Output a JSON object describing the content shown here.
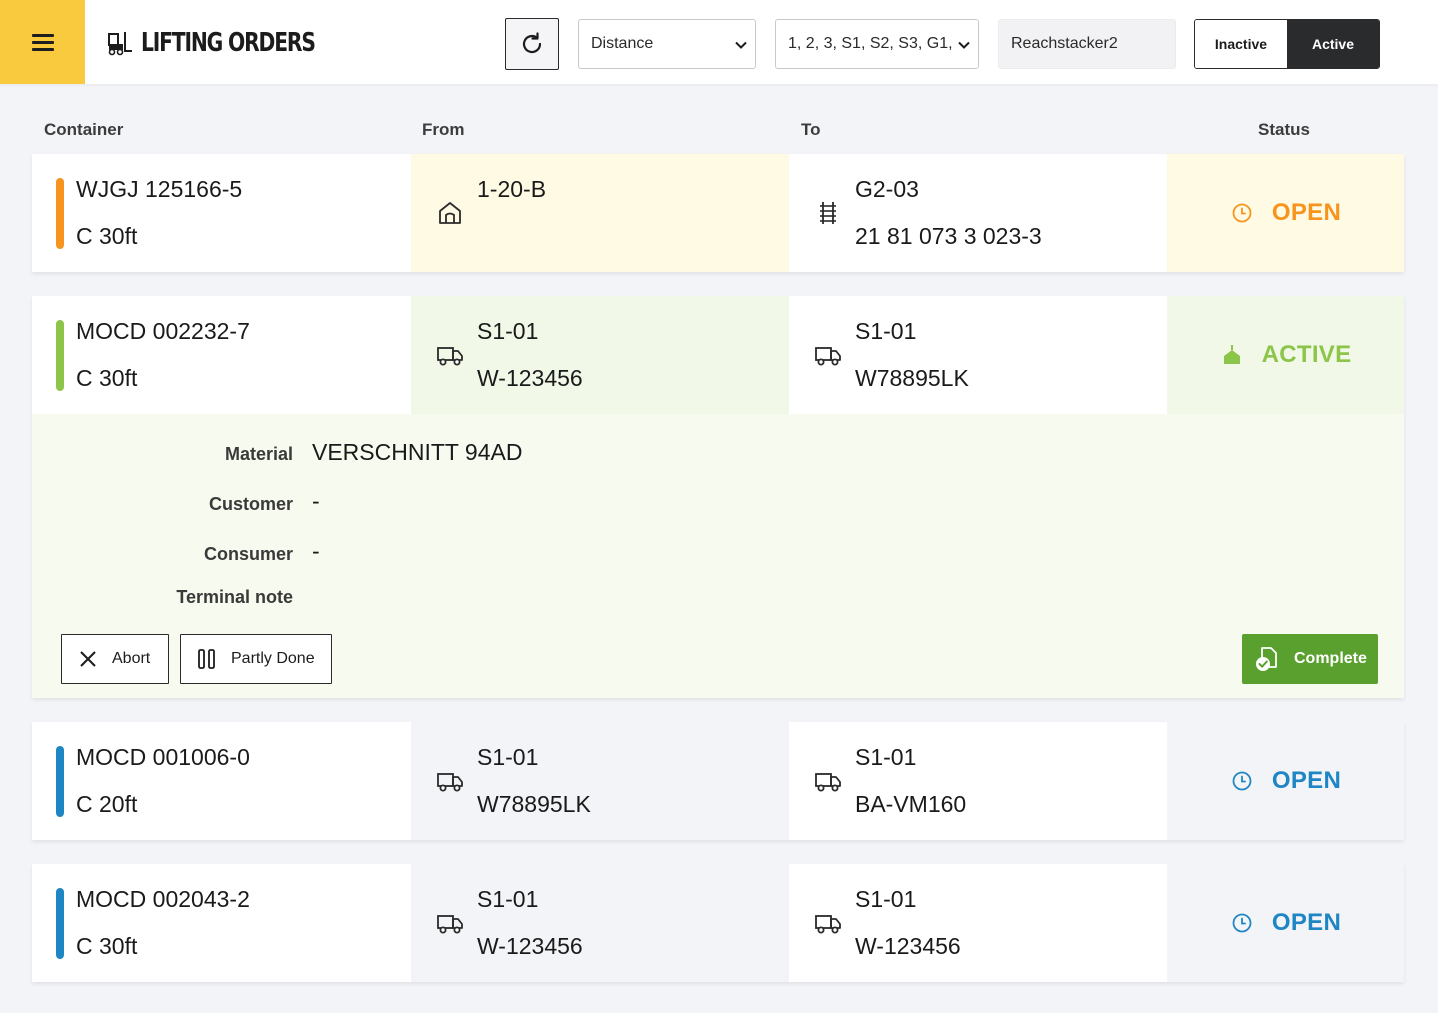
{
  "header": {
    "title": "LIFTING ORDERS",
    "sort_select": "Distance",
    "zone_select": "1, 2, 3, S1, S2, S3, G1, …",
    "machine": "Reachstacker2",
    "toggle_inactive": "Inactive",
    "toggle_active": "Active",
    "active_toggle": "Active"
  },
  "columns": {
    "container": "Container",
    "from": "From",
    "to": "To",
    "status": "Status"
  },
  "orders": [
    {
      "container_id": "WJGJ 125166-5",
      "container_type": "C 30ft",
      "from_icon": "warehouse-icon",
      "from_line1": "1-20-B",
      "from_line2": "",
      "to_icon": "rail-track-icon",
      "to_line1": "G2-03",
      "to_line2": "21 81 073 3 023-3",
      "status": "OPEN",
      "status_icon": "clock-icon",
      "accent": "#f7941d"
    },
    {
      "container_id": "MOCD 002232-7",
      "container_type": "C 30ft",
      "from_icon": "truck-icon",
      "from_line1": "S1-01",
      "from_line2": "W-123456",
      "to_icon": "truck-icon",
      "to_line1": "S1-01",
      "to_line2": "W78895LK",
      "status": "ACTIVE",
      "status_icon": "crane-lift-icon",
      "accent": "#8cc54a"
    },
    {
      "container_id": "MOCD 001006-0",
      "container_type": "C 20ft",
      "from_icon": "truck-icon",
      "from_line1": "S1-01",
      "from_line2": "W78895LK",
      "to_icon": "truck-icon",
      "to_line1": "S1-01",
      "to_line2": "BA-VM160",
      "status": "OPEN",
      "status_icon": "clock-icon",
      "accent": "#1f86c4"
    },
    {
      "container_id": "MOCD 002043-2",
      "container_type": "C 30ft",
      "from_icon": "truck-icon",
      "from_line1": "S1-01",
      "from_line2": "W-123456",
      "to_icon": "truck-icon",
      "to_line1": "S1-01",
      "to_line2": "W-123456",
      "status": "OPEN",
      "status_icon": "clock-icon",
      "accent": "#1f86c4"
    }
  ],
  "details": {
    "material_label": "Material",
    "material_value": "VERSCHNITT 94AD",
    "customer_label": "Customer",
    "customer_value": "-",
    "consumer_label": "Consumer",
    "consumer_value": "-",
    "terminal_note_label": "Terminal note",
    "terminal_note_value": "",
    "abort_label": "Abort",
    "partly_done_label": "Partly Done",
    "complete_label": "Complete"
  },
  "colors": {
    "brand_yellow": "#f9c93e",
    "open_orange": "#f7941d",
    "active_green": "#8cc54a",
    "open_blue": "#1f86c4",
    "complete_green": "#5aa02e"
  }
}
